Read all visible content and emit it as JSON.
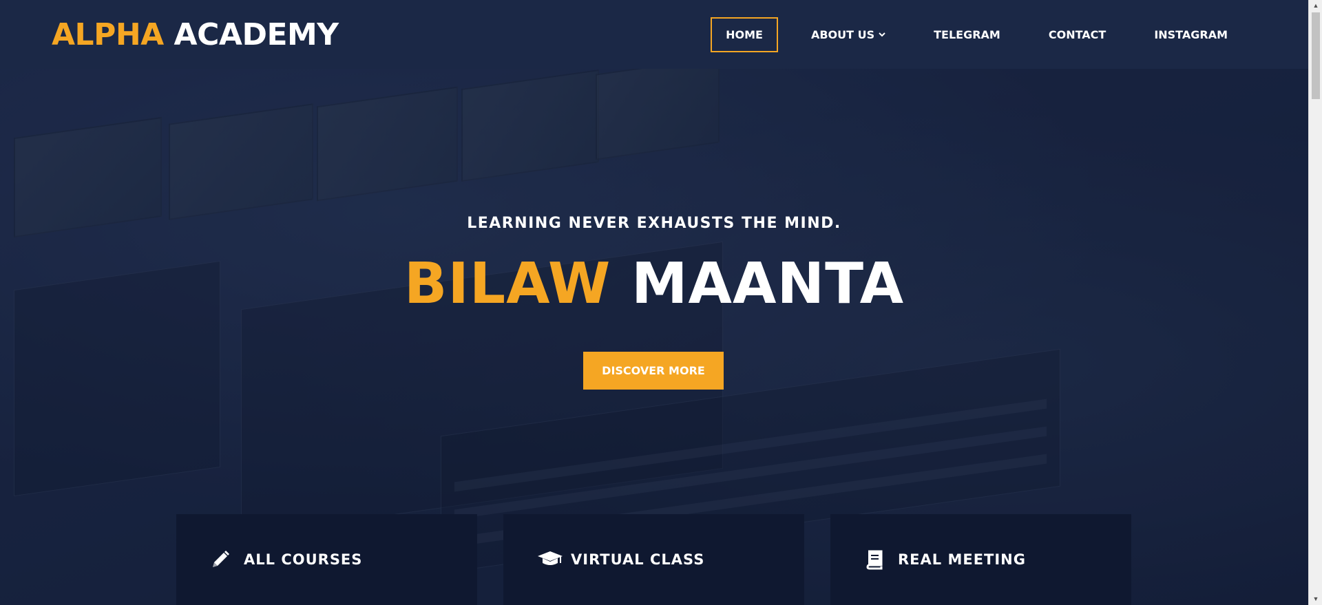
{
  "header": {
    "logo_accent": "ALPHA",
    "logo_rest": "ACADEMY",
    "nav": [
      {
        "label": "HOME",
        "active": true
      },
      {
        "label": "ABOUT US",
        "has_dropdown": true
      },
      {
        "label": "TELEGRAM"
      },
      {
        "label": "CONTACT"
      },
      {
        "label": "INSTAGRAM"
      }
    ]
  },
  "hero": {
    "tagline": "LEARNING NEVER EXHAUSTS THE MIND.",
    "title_accent": "BILAW",
    "title_rest": "MAANTA",
    "cta_label": "DISCOVER MORE"
  },
  "cards": [
    {
      "label": "ALL COURSES",
      "icon": "pencil-icon"
    },
    {
      "label": "VIRTUAL CLASS",
      "icon": "graduation-cap-icon"
    },
    {
      "label": "REAL MEETING",
      "icon": "book-icon"
    }
  ],
  "colors": {
    "accent": "#f5a623",
    "header_bg": "#1b2846",
    "card_bg": "#0f1830"
  }
}
